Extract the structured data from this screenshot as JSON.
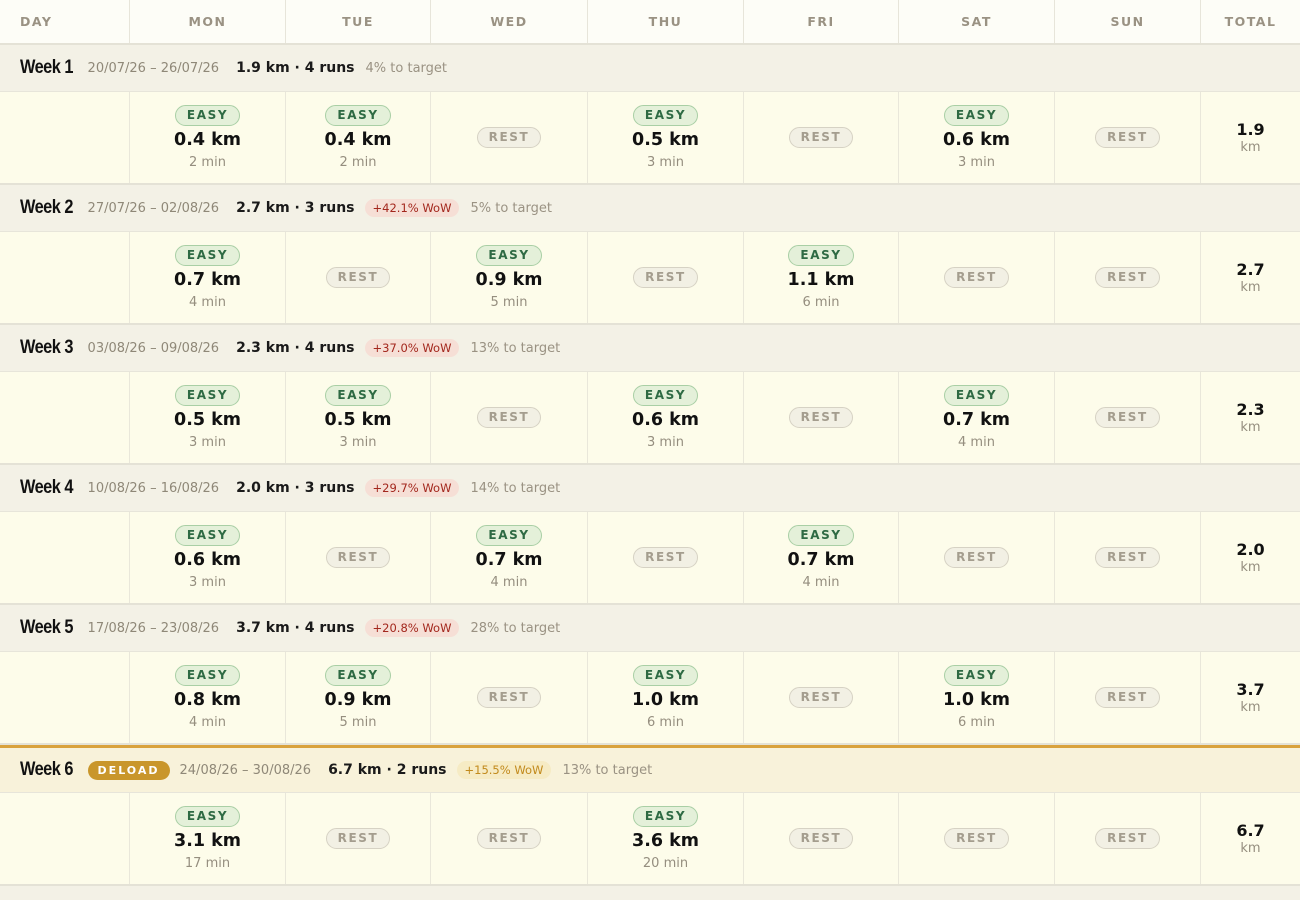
{
  "header": {
    "columns": [
      "DAY",
      "MON",
      "TUE",
      "WED",
      "THU",
      "FRI",
      "SAT",
      "SUN",
      "TOTAL"
    ]
  },
  "weeks": [
    {
      "title": "Week 1",
      "dates": "20/07/26 – 26/07/26",
      "summary": "1.9 km · 4 runs",
      "wow": "",
      "target": "4% to target",
      "deload": "",
      "days": [
        {
          "type": "EASY",
          "km": "0.4 km",
          "min": "2 min"
        },
        {
          "type": "EASY",
          "km": "0.4 km",
          "min": "2 min"
        },
        {
          "type": "REST"
        },
        {
          "type": "EASY",
          "km": "0.5 km",
          "min": "3 min"
        },
        {
          "type": "REST"
        },
        {
          "type": "EASY",
          "km": "0.6 km",
          "min": "3 min"
        },
        {
          "type": "REST"
        }
      ],
      "total": "1.9",
      "total_unit": "km"
    },
    {
      "title": "Week 2",
      "dates": "27/07/26 – 02/08/26",
      "summary": "2.7 km · 3 runs",
      "wow": "+42.1% WoW",
      "target": "5% to target",
      "deload": "",
      "days": [
        {
          "type": "EASY",
          "km": "0.7 km",
          "min": "4 min"
        },
        {
          "type": "REST"
        },
        {
          "type": "EASY",
          "km": "0.9 km",
          "min": "5 min"
        },
        {
          "type": "REST"
        },
        {
          "type": "EASY",
          "km": "1.1 km",
          "min": "6 min"
        },
        {
          "type": "REST"
        },
        {
          "type": "REST"
        }
      ],
      "total": "2.7",
      "total_unit": "km"
    },
    {
      "title": "Week 3",
      "dates": "03/08/26 – 09/08/26",
      "summary": "2.3 km · 4 runs",
      "wow": "+37.0% WoW",
      "target": "13% to target",
      "deload": "",
      "days": [
        {
          "type": "EASY",
          "km": "0.5 km",
          "min": "3 min"
        },
        {
          "type": "EASY",
          "km": "0.5 km",
          "min": "3 min"
        },
        {
          "type": "REST"
        },
        {
          "type": "EASY",
          "km": "0.6 km",
          "min": "3 min"
        },
        {
          "type": "REST"
        },
        {
          "type": "EASY",
          "km": "0.7 km",
          "min": "4 min"
        },
        {
          "type": "REST"
        }
      ],
      "total": "2.3",
      "total_unit": "km"
    },
    {
      "title": "Week 4",
      "dates": "10/08/26 – 16/08/26",
      "summary": "2.0 km · 3 runs",
      "wow": "+29.7% WoW",
      "target": "14% to target",
      "deload": "",
      "days": [
        {
          "type": "EASY",
          "km": "0.6 km",
          "min": "3 min"
        },
        {
          "type": "REST"
        },
        {
          "type": "EASY",
          "km": "0.7 km",
          "min": "4 min"
        },
        {
          "type": "REST"
        },
        {
          "type": "EASY",
          "km": "0.7 km",
          "min": "4 min"
        },
        {
          "type": "REST"
        },
        {
          "type": "REST"
        }
      ],
      "total": "2.0",
      "total_unit": "km"
    },
    {
      "title": "Week 5",
      "dates": "17/08/26 – 23/08/26",
      "summary": "3.7 km · 4 runs",
      "wow": "+20.8% WoW",
      "target": "28% to target",
      "deload": "",
      "days": [
        {
          "type": "EASY",
          "km": "0.8 km",
          "min": "4 min"
        },
        {
          "type": "EASY",
          "km": "0.9 km",
          "min": "5 min"
        },
        {
          "type": "REST"
        },
        {
          "type": "EASY",
          "km": "1.0 km",
          "min": "6 min"
        },
        {
          "type": "REST"
        },
        {
          "type": "EASY",
          "km": "1.0 km",
          "min": "6 min"
        },
        {
          "type": "REST"
        }
      ],
      "total": "3.7",
      "total_unit": "km"
    },
    {
      "title": "Week 6",
      "dates": "24/08/26 – 30/08/26",
      "summary": "6.7 km · 2 runs",
      "wow": "+15.5% WoW",
      "target": "13% to target",
      "deload": "DELOAD",
      "days": [
        {
          "type": "EASY",
          "km": "3.1 km",
          "min": "17 min"
        },
        {
          "type": "REST"
        },
        {
          "type": "REST"
        },
        {
          "type": "EASY",
          "km": "3.6 km",
          "min": "20 min"
        },
        {
          "type": "REST"
        },
        {
          "type": "REST"
        },
        {
          "type": "REST"
        }
      ],
      "total": "6.7",
      "total_unit": "km"
    }
  ],
  "colors": {
    "easy_text": "#2e6a43",
    "easy_bg": "#e4f0d9",
    "rest_text": "#a49d8e",
    "wow_text": "#a3271d",
    "deload_accent": "#c9962b",
    "cell_bg": "#fdfcea",
    "week_header_bg": "#f3f1e6"
  }
}
